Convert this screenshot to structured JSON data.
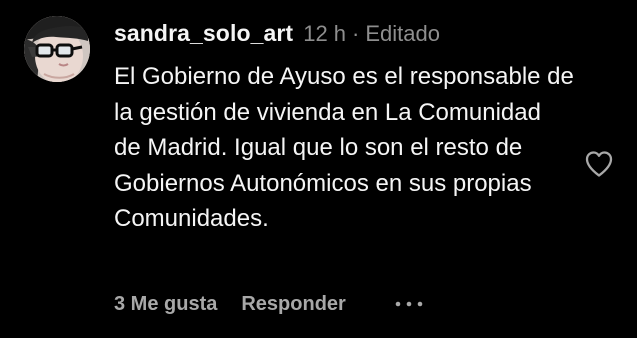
{
  "theme": {
    "background": "#000000",
    "text_primary": "#f5f5f5",
    "text_secondary": "#8e8e8e",
    "action_text": "#a8a8a8"
  },
  "comment": {
    "avatar_icon": "profile-avatar",
    "username": "sandra_solo_art",
    "time": "12 h",
    "separator": "·",
    "edited": "Editado",
    "text": "El Gobierno de Ayuso es el responsable de la gestión de vivienda en La Comunidad de Madrid. Igual que lo son el resto de Gobiernos Autonómicos en sus propias Comunidades.",
    "likes": "3 Me gusta",
    "reply": "Responder",
    "like_icon": "heart-outline-icon",
    "more_icon": "more-horizontal-icon"
  }
}
